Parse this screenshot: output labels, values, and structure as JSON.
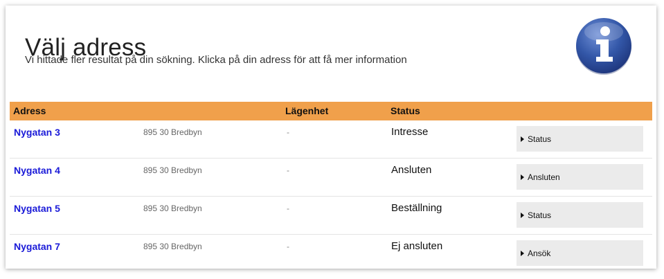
{
  "page": {
    "title": "Välj adress",
    "subtitle": "Vi hittade fler resultat på din sökning. Klicka på din adress för att få mer information"
  },
  "info_icon": {
    "name": "info-icon",
    "glyph": "i",
    "color": "#2f4e9c"
  },
  "colors": {
    "header_bar": "#f0a04b",
    "address_link": "#1a1ad8",
    "button_bg": "#ebebeb"
  },
  "table": {
    "headers": {
      "address": "Adress",
      "apartment": "Lägenhet",
      "status": "Status"
    },
    "rows": [
      {
        "address": "Nygatan 3",
        "postal": "895 30 Bredbyn",
        "apartment": "-",
        "status": "Intresse",
        "action": "Status"
      },
      {
        "address": "Nygatan 4",
        "postal": "895 30 Bredbyn",
        "apartment": "-",
        "status": "Ansluten",
        "action": "Ansluten"
      },
      {
        "address": "Nygatan 5",
        "postal": "895 30 Bredbyn",
        "apartment": "-",
        "status": "Beställning",
        "action": "Status"
      },
      {
        "address": "Nygatan 7",
        "postal": "895 30 Bredbyn",
        "apartment": "-",
        "status": "Ej ansluten",
        "action": "Ansök"
      }
    ]
  }
}
